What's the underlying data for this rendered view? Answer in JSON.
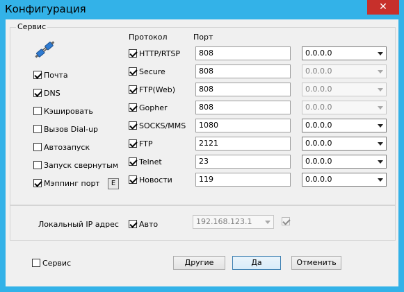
{
  "window": {
    "title": "Конфигурация",
    "close_glyph": "✕"
  },
  "service_group": {
    "legend": "Сервис",
    "header_protocol": "Протокол",
    "header_port": "Порт",
    "left_options": [
      {
        "label": "Почта",
        "checked": true
      },
      {
        "label": "DNS",
        "checked": true
      },
      {
        "label": "Кэшировать",
        "checked": false
      },
      {
        "label": "Вызов Dial-up",
        "checked": false
      },
      {
        "label": "Автозапуск",
        "checked": false
      },
      {
        "label": "Запуск свернутым",
        "checked": false
      },
      {
        "label": "Мэппинг портов",
        "checked": true
      }
    ],
    "mapping_edit_label": "E",
    "protocols": [
      {
        "name": "HTTP/RTSP",
        "checked": true,
        "port": "808",
        "ip": "0.0.0.0",
        "ip_enabled": true
      },
      {
        "name": "Secure",
        "checked": true,
        "port": "808",
        "ip": "0.0.0.0",
        "ip_enabled": false
      },
      {
        "name": "FTP(Web)",
        "checked": true,
        "port": "808",
        "ip": "0.0.0.0",
        "ip_enabled": false
      },
      {
        "name": "Gopher",
        "checked": true,
        "port": "808",
        "ip": "0.0.0.0",
        "ip_enabled": false
      },
      {
        "name": "SOCKS/MMS",
        "checked": true,
        "port": "1080",
        "ip": "0.0.0.0",
        "ip_enabled": true
      },
      {
        "name": "FTP",
        "checked": true,
        "port": "2121",
        "ip": "0.0.0.0",
        "ip_enabled": true
      },
      {
        "name": "Telnet",
        "checked": true,
        "port": "23",
        "ip": "0.0.0.0",
        "ip_enabled": true
      },
      {
        "name": "Новости",
        "checked": true,
        "port": "119",
        "ip": "0.0.0.0",
        "ip_enabled": true
      }
    ]
  },
  "local_ip": {
    "label": "Локальный IP адрес",
    "auto_label": "Авто",
    "auto_checked": true,
    "ip_value": "192.168.123.1",
    "extra_checked": true
  },
  "footer": {
    "service_label": "Сервис",
    "service_checked": false,
    "other_button": "Другие",
    "ok_button": "Да",
    "cancel_button": "Отменить"
  },
  "colors": {
    "titlebar": "#33b2e8",
    "close": "#c7302b"
  }
}
